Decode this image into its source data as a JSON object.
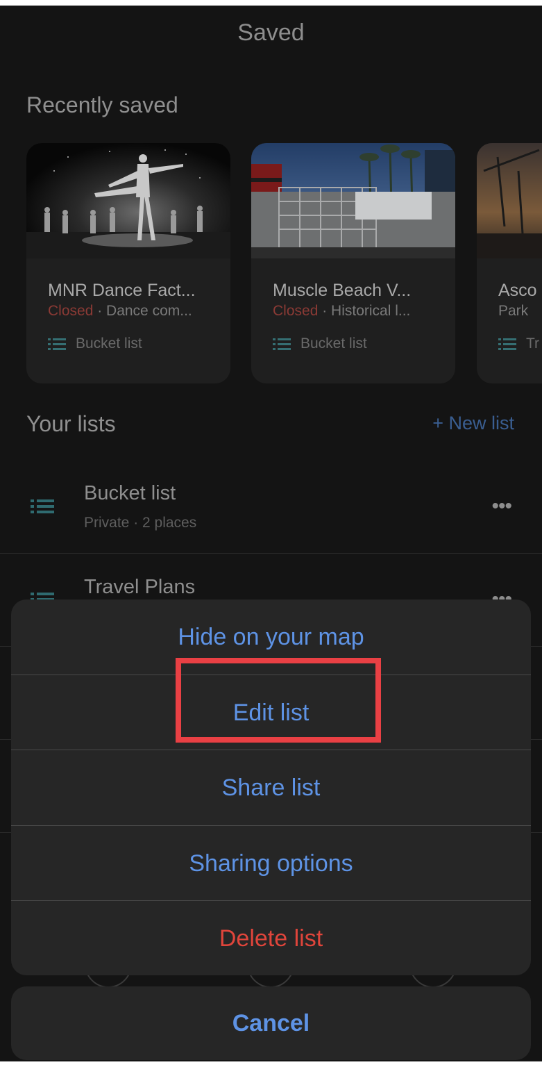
{
  "header": {
    "title": "Saved"
  },
  "recently_saved": {
    "title": "Recently saved",
    "cards": [
      {
        "title": "MNR Dance Fact...",
        "status": "Closed",
        "category": " · Dance com...",
        "list": "Bucket list"
      },
      {
        "title": "Muscle Beach V...",
        "status": "Closed",
        "category": " · Historical l...",
        "list": "Bucket list"
      },
      {
        "title": "Asco",
        "status": "",
        "category": "Park",
        "list": "Tr"
      }
    ]
  },
  "your_lists": {
    "title": "Your lists",
    "new_list_label": "+ New list",
    "items": [
      {
        "title": "Bucket list",
        "subtitle": "Private · 2 places",
        "more": "•••"
      },
      {
        "title": "Travel Plans",
        "more": "•••"
      }
    ]
  },
  "action_sheet": {
    "actions": [
      {
        "label": "Hide on your map"
      },
      {
        "label": "Edit list"
      },
      {
        "label": "Share list"
      },
      {
        "label": "Sharing options"
      },
      {
        "label": "Delete list"
      }
    ],
    "cancel_label": "Cancel"
  },
  "colors": {
    "accent_blue": "#5e93e5",
    "danger_red": "#e0453b",
    "highlight_red": "#e94044"
  }
}
